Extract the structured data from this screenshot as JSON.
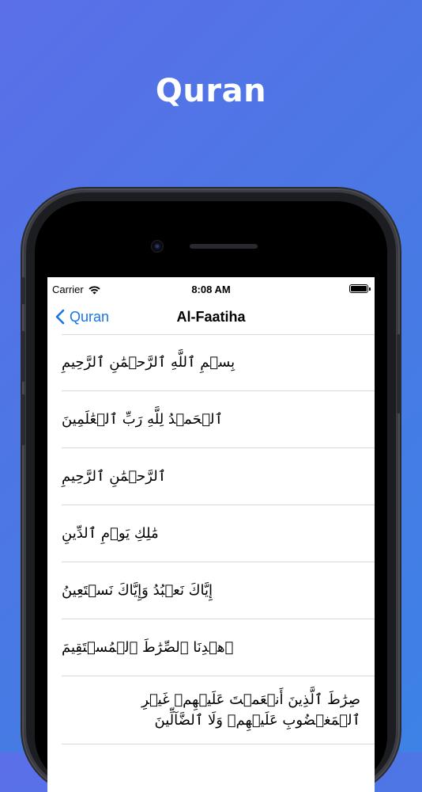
{
  "promo": {
    "title": "Quran"
  },
  "status_bar": {
    "carrier": "Carrier",
    "time": "8:08 AM"
  },
  "nav": {
    "back_label": "Quran",
    "title": "Al-Faatiha"
  },
  "verses": [
    "بِسۡمِ ٱللَّهِ ٱلرَّحۡمَٰنِ ٱلرَّحِيمِ",
    "ٱلۡحَمۡدُ لِلَّهِ رَبِّ ٱلۡعَٰلَمِينَ",
    "ٱلرَّحۡمَٰنِ ٱلرَّحِيمِ",
    "مَٰلِكِ يَوۡمِ ٱلدِّينِ",
    "إِيَّاكَ نَعۡبُدُ وَإِيَّاكَ نَسۡتَعِينُ",
    "ٱهۡدِنَا ٱلصِّرَٰطَ ٱلۡمُسۡتَقِيمَ",
    "صِرَٰطَ ٱلَّذِينَ أَنۡعَمۡتَ عَلَيۡهِمۡ غَيۡرِ ٱلۡمَغۡضُوبِ عَلَيۡهِمۡ وَلَا ٱلضَّآلِّينَ"
  ],
  "colors": {
    "accent": "#1a73e8",
    "background_gradient": [
      "#5a6fe8",
      "#3d82e6"
    ]
  },
  "icons": {
    "back": "chevron-left-icon",
    "wifi": "wifi-icon",
    "battery": "battery-icon"
  }
}
